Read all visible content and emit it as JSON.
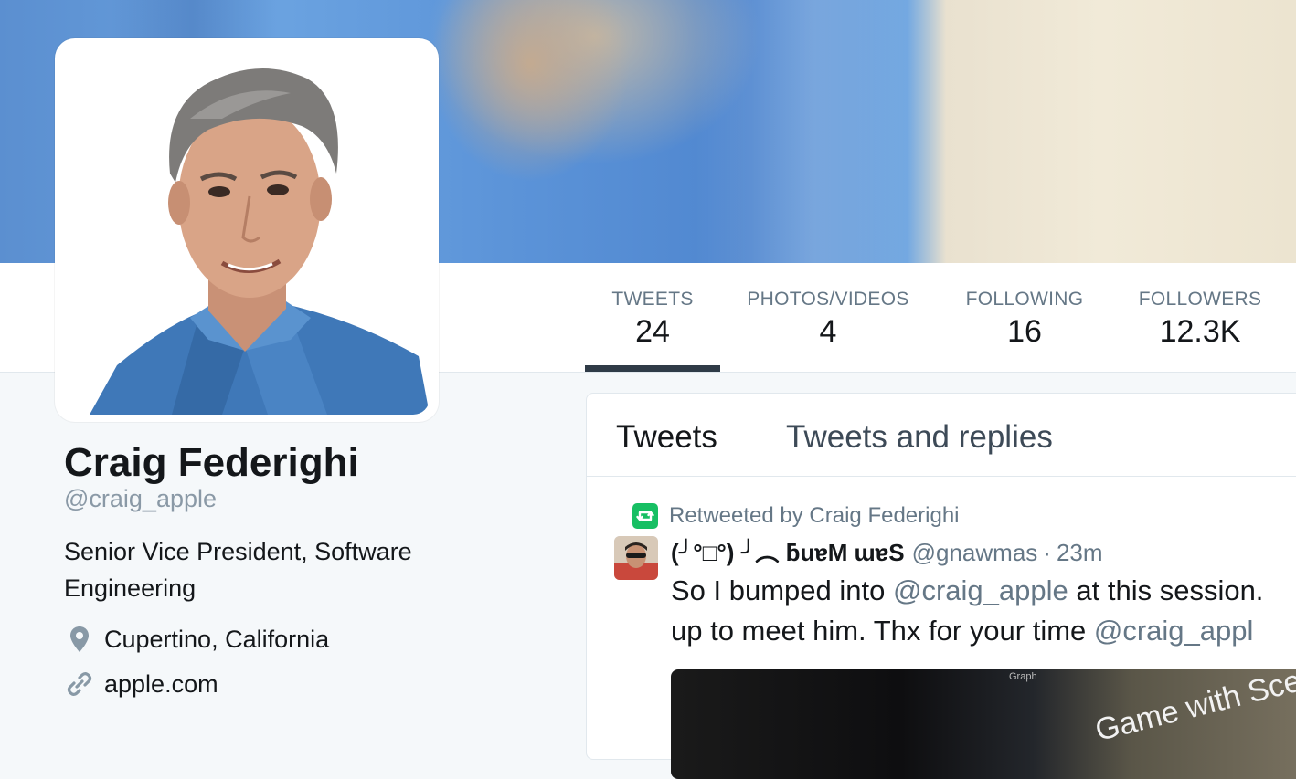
{
  "profile": {
    "name": "Craig Federighi",
    "handle": "@craig_apple",
    "bio": "Senior Vice President, Software Engineering",
    "location": "Cupertino, California",
    "website": "apple.com"
  },
  "stats": [
    {
      "label": "TWEETS",
      "value": "24",
      "active": true
    },
    {
      "label": "PHOTOS/VIDEOS",
      "value": "4",
      "active": false
    },
    {
      "label": "FOLLOWING",
      "value": "16",
      "active": false
    },
    {
      "label": "FOLLOWERS",
      "value": "12.3K",
      "active": false
    }
  ],
  "timeline": {
    "tabs": [
      "Tweets",
      "Tweets and replies"
    ],
    "tweet": {
      "retweeted_by": "Retweeted by Craig Federighi",
      "author": "(╯°□°) ╯︵ ƃuɐM ɯɐS",
      "user_handle": "@gnawmas",
      "separator": "·",
      "time": "23m",
      "text_part1": "So I bumped into ",
      "mention1": "@craig_apple",
      "text_part2": " at this session.",
      "text_line2": "up to meet him. Thx for your time ",
      "mention2": "@craig_appl",
      "media_caption": "Game with Sce",
      "media_small": "Graph"
    }
  },
  "icons": {
    "location": "map-pin-icon",
    "link": "link-icon",
    "retweet": "retweet-icon"
  },
  "colors": {
    "retweet_green": "#17bf63",
    "muted_text": "#657786",
    "active_underline": "#2f3b47"
  }
}
